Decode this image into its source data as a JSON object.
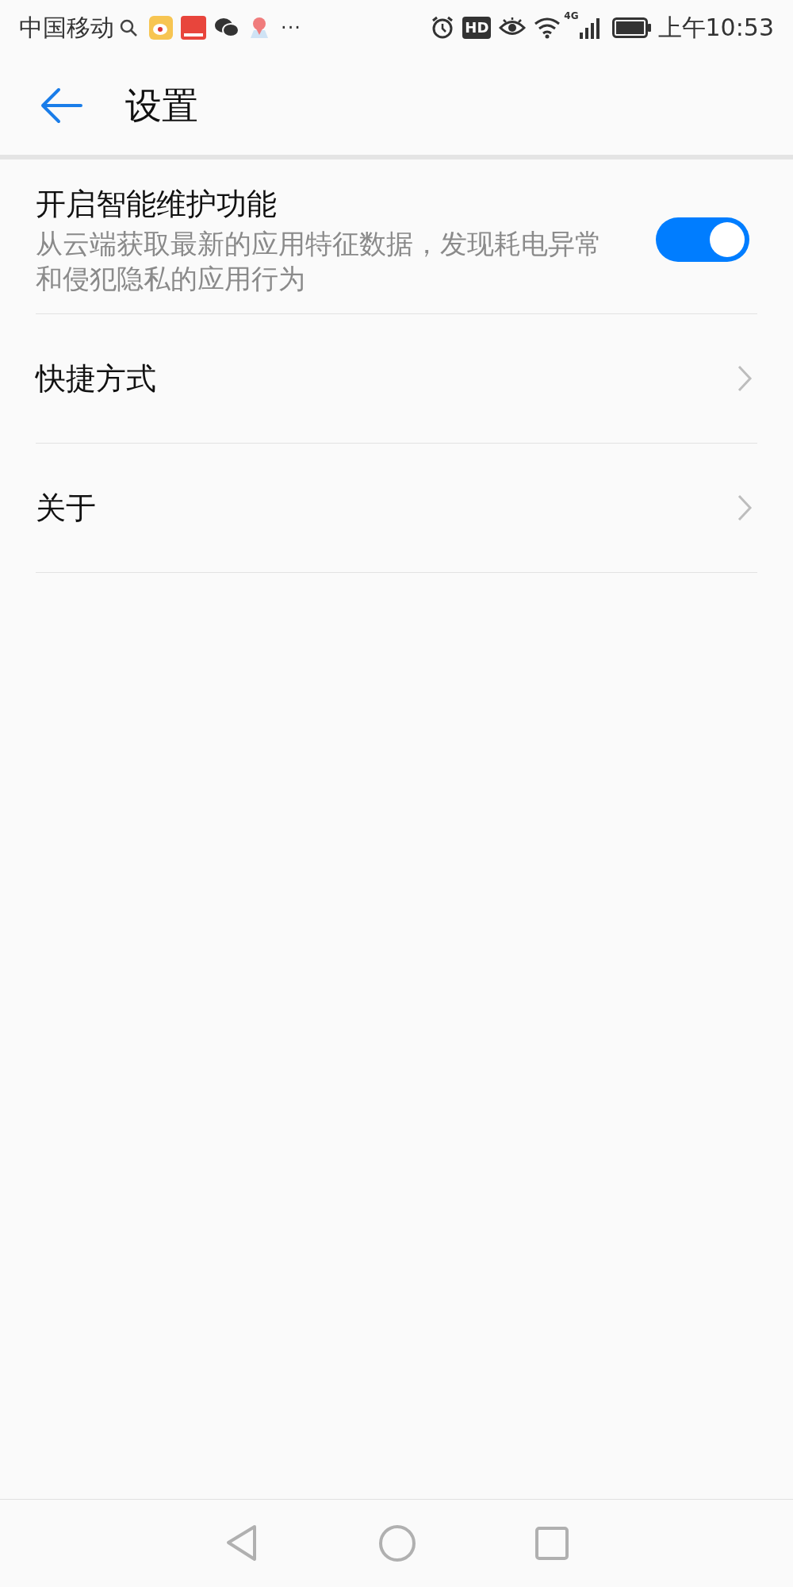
{
  "status_bar": {
    "carrier": "中国移动",
    "more": "···",
    "hd_badge": "HD",
    "network": "4G",
    "time": "上午10:53"
  },
  "header": {
    "title": "设置"
  },
  "settings": [
    {
      "kind": "toggle",
      "title": "开启智能维护功能",
      "subtitle": "从云端获取最新的应用特征数据，发现耗电异常和侵犯隐私的应用行为",
      "on": true
    },
    {
      "kind": "link",
      "title": "快捷方式"
    },
    {
      "kind": "link",
      "title": "关于"
    }
  ]
}
